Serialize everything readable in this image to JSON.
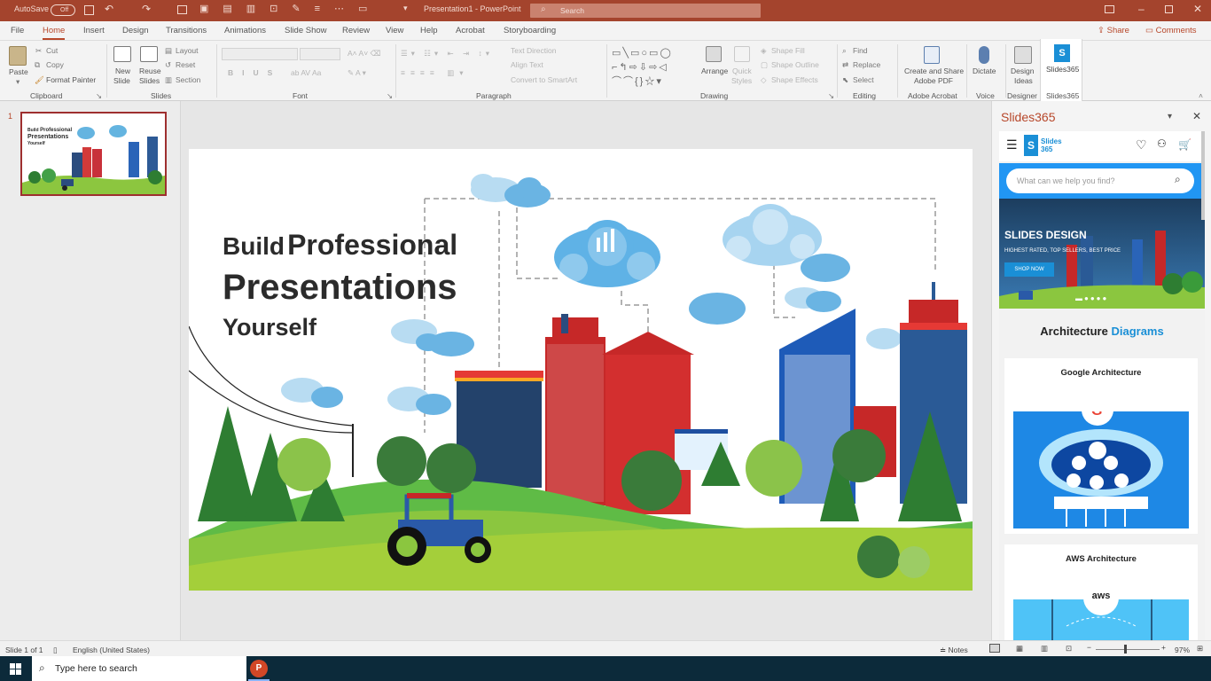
{
  "titlebar": {
    "autosave_label": "AutoSave",
    "autosave_state": "Off",
    "document_title": "Presentation1 - PowerPoint",
    "search_placeholder": "Search"
  },
  "tabs": [
    "File",
    "Home",
    "Insert",
    "Design",
    "Transitions",
    "Animations",
    "Slide Show",
    "Review",
    "View",
    "Help",
    "Acrobat",
    "Storyboarding"
  ],
  "share_label": "Share",
  "comments_label": "Comments",
  "ribbon": {
    "clipboard": {
      "paste": "Paste",
      "cut": "Cut",
      "copy": "Copy",
      "format_painter": "Format Painter",
      "label": "Clipboard"
    },
    "slides": {
      "new_slide_1": "New",
      "new_slide_2": "Slide",
      "reuse_1": "Reuse",
      "reuse_2": "Slides",
      "layout": "Layout",
      "reset": "Reset",
      "section": "Section",
      "label": "Slides"
    },
    "font": {
      "label": "Font"
    },
    "paragraph": {
      "text_direction": "Text Direction",
      "align_text": "Align Text",
      "smartart": "Convert to SmartArt",
      "label": "Paragraph"
    },
    "drawing": {
      "arrange": "Arrange",
      "quick_styles_1": "Quick",
      "quick_styles_2": "Styles",
      "shape_fill": "Shape Fill",
      "shape_outline": "Shape Outline",
      "shape_effects": "Shape Effects",
      "label": "Drawing"
    },
    "editing": {
      "find": "Find",
      "replace": "Replace",
      "select": "Select",
      "label": "Editing"
    },
    "acrobat": {
      "create_1": "Create and Share",
      "create_2": "Adobe PDF",
      "label": "Adobe Acrobat"
    },
    "voice": {
      "dictate": "Dictate",
      "label": "Voice"
    },
    "designer": {
      "design_1": "Design",
      "design_2": "Ideas",
      "label": "Designer"
    },
    "slides365": {
      "button": "Slides365",
      "label": "Slides365"
    }
  },
  "thumbnail": {
    "number": "1",
    "line1_a": "Build",
    "line1_b": "Professional",
    "line2": "Presentations",
    "line3": "Yourself"
  },
  "slide": {
    "title_build": "Build",
    "title_professional": "Professional",
    "title_presentations": "Presentations",
    "title_yourself": "Yourself"
  },
  "side_panel": {
    "title": "Slides365",
    "logo_text_1": "Slides",
    "logo_text_2": "365",
    "search_placeholder": "What can we help you find?",
    "banner_title": "SLIDES DESIGN",
    "banner_sub": "HIGHEST RATED, TOP SELLERS, BEST PRICE",
    "banner_button": "SHOP NOW",
    "section_title_a": "Architecture",
    "section_title_b": "Diagrams",
    "card1_title": "Google Architecture",
    "card2_title": "AWS Architecture",
    "aws_logo_text": "aws"
  },
  "status": {
    "slide_count": "Slide 1 of 1",
    "language": "English (United States)",
    "notes": "Notes",
    "zoom": "97%"
  },
  "taskbar": {
    "search_placeholder": "Type here to search"
  },
  "colors": {
    "titlebar": "#a4442d",
    "accent": "#b7472a",
    "slides365_blue": "#1a8fd6"
  }
}
